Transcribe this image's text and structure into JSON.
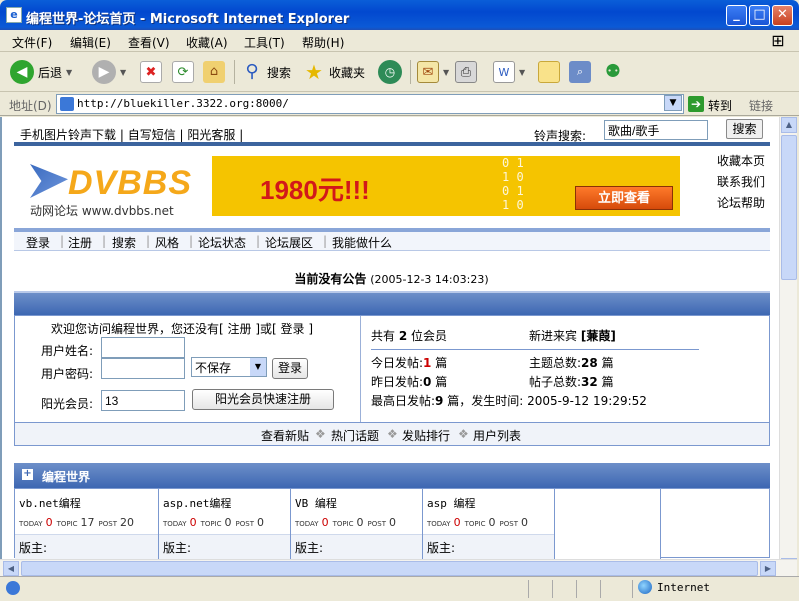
{
  "window": {
    "title": "编程世界-论坛首页 - Microsoft Internet Explorer"
  },
  "menu": [
    "文件(F)",
    "编辑(E)",
    "查看(V)",
    "收藏(A)",
    "工具(T)",
    "帮助(H)"
  ],
  "toolbar": {
    "back": "后退",
    "search": "搜索",
    "favorites": "收藏夹"
  },
  "address": {
    "label": "地址(D)",
    "url": "http://bluekiller.3322.org:8000/",
    "go": "转到",
    "links": "链接"
  },
  "page": {
    "toplinks": [
      "手机图片铃声下载",
      "自写短信",
      "阳光客服"
    ],
    "search_label": "铃声搜索:",
    "search_value": "歌曲/歌手",
    "search_button": "搜索",
    "logo_text": "DVBBS",
    "logo_sub": "动网论坛 www.dvbbs.net",
    "banner_price": "1980元!!!",
    "banner_button": "立即查看",
    "right_links": [
      "收藏本页",
      "联系我们",
      "论坛帮助"
    ],
    "nav": [
      "登录",
      "注册",
      "搜索",
      "风格",
      "论坛状态",
      "论坛展区",
      "我能做什么"
    ],
    "announce_title": "当前没有公告",
    "announce_time": "(2005-12-3 14:03:23)",
    "welcome": {
      "prefix": "欢迎您访问编程世界，您还没有",
      "register": "[ 注册 ]",
      "or": "或",
      "login": "[ 登录 ]"
    },
    "login": {
      "username_label": "用户姓名:",
      "password_label": "用户密码:",
      "save_option": "不保存",
      "login_button": "登录",
      "member_label": "阳光会员:",
      "member_value": "13",
      "quick_register": "阳光会员快速注册"
    },
    "stats": {
      "members_prefix": "共有",
      "members_count": "2",
      "members_suffix": "位会员",
      "newest_label": "新进来宾",
      "newest_name": "[蒹葭]",
      "today_label": "今日发帖:",
      "today_value": "1",
      "topics_label": "主题总数:",
      "topics_value": "28",
      "yesterday_label": "昨日发帖:",
      "yesterday_value": "0",
      "posts_label": "帖子总数:",
      "posts_value": "32",
      "max_label": "最高日发帖:",
      "max_value": "9",
      "max_time": "篇，发生时间: 2005-9-12 19:29:52",
      "unit": "篇"
    },
    "links_bar": [
      "查看新贴",
      "热门话题",
      "发贴排行",
      "用户列表"
    ],
    "category": "编程世界",
    "forums": [
      {
        "name": "vb.net编程",
        "today": "0",
        "topic": "17",
        "post": "20",
        "mod": "版主:"
      },
      {
        "name": "asp.net编程",
        "today": "0",
        "topic": "0",
        "post": "0",
        "mod": "版主:"
      },
      {
        "name": "VB 编程",
        "today": "0",
        "topic": "0",
        "post": "0",
        "mod": "版主:"
      },
      {
        "name": "asp 编程",
        "today": "0",
        "topic": "0",
        "post": "0",
        "mod": "版主:"
      }
    ],
    "forum_labels": {
      "today": "TODAY",
      "topic": "TOPIC",
      "post": "POST"
    }
  },
  "status": {
    "zone": "Internet"
  }
}
